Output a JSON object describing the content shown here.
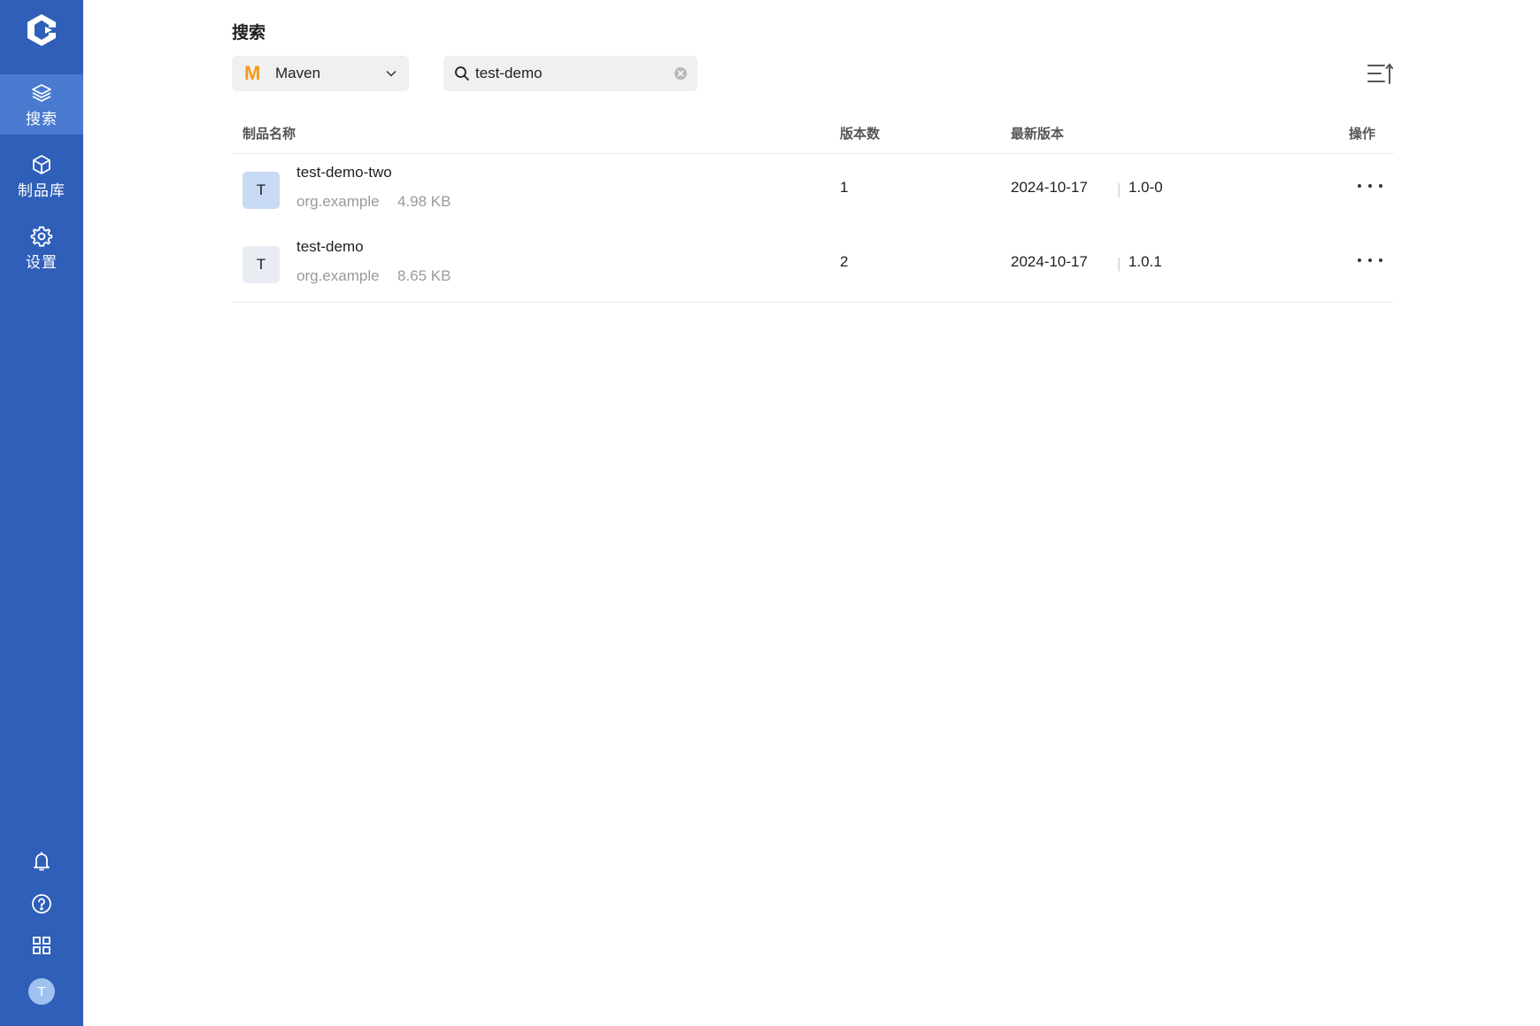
{
  "nav": {
    "items": [
      {
        "label": "搜索",
        "icon": "layers-icon",
        "active": true
      },
      {
        "label": "制品库",
        "icon": "cube-icon",
        "active": false
      },
      {
        "label": "设置",
        "icon": "gear-icon",
        "active": false
      }
    ],
    "bottom": [
      "bell-icon",
      "help-icon",
      "apps-grid-icon",
      "user-avatar"
    ],
    "avatar_letter": "T"
  },
  "header": {
    "title": "搜索"
  },
  "filters": {
    "type_select": {
      "value": "Maven",
      "icon_letter": "M"
    },
    "search": {
      "value": "test-demo",
      "placeholder": ""
    }
  },
  "table": {
    "columns": [
      "制品名称",
      "版本数",
      "最新版本",
      "操作"
    ],
    "rows": [
      {
        "initial": "T",
        "name": "test-demo-two",
        "group": "org.example",
        "size": "4.98 KB",
        "versions": "1",
        "date": "2024-10-17",
        "latest": "1.0-0",
        "initial_bg": "#c9daf5"
      },
      {
        "initial": "T",
        "name": "test-demo",
        "group": "org.example",
        "size": "8.65 KB",
        "versions": "2",
        "date": "2024-10-17",
        "latest": "1.0.1",
        "initial_bg": "#e9ecf3"
      }
    ]
  },
  "colors": {
    "sidebar": "#2f5fb8",
    "sidebar_active": "#4a7ad0",
    "maven": "#f29b1b"
  }
}
